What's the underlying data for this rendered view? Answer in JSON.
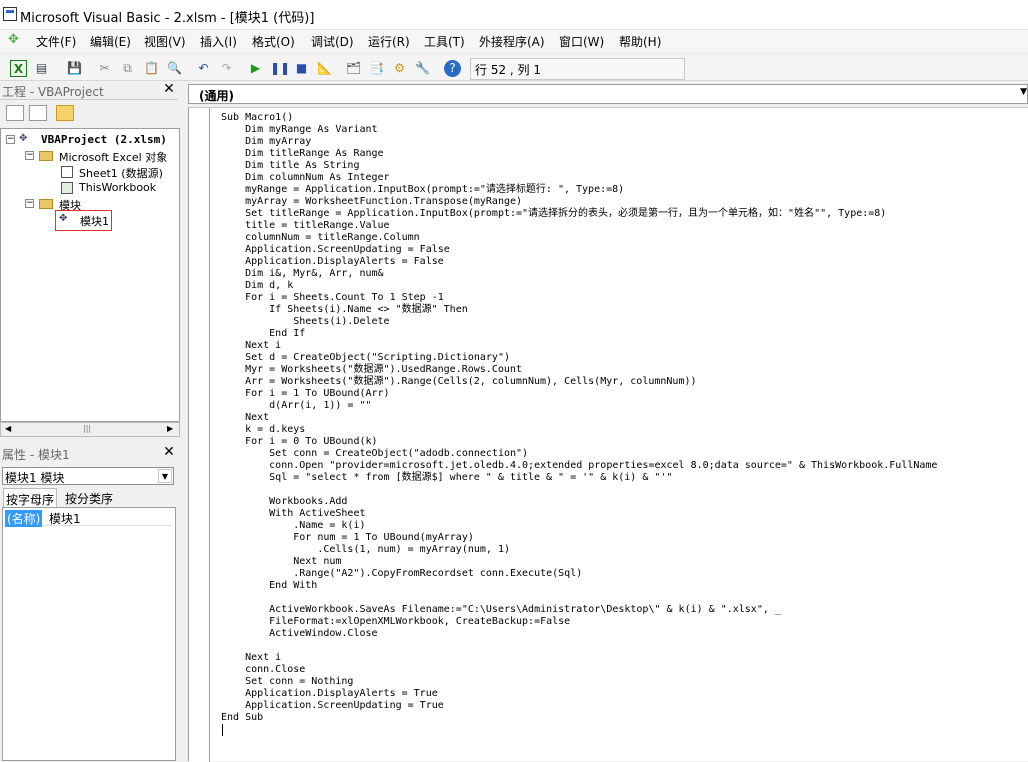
{
  "window": {
    "title": "Microsoft Visual Basic - 2.xlsm - [模块1 (代码)]"
  },
  "menu": [
    "文件(F)",
    "编辑(E)",
    "视图(V)",
    "插入(I)",
    "格式(O)",
    "调试(D)",
    "运行(R)",
    "工具(T)",
    "外接程序(A)",
    "窗口(W)",
    "帮助(H)"
  ],
  "toolbar": {
    "position": "行 52 , 列 1"
  },
  "project": {
    "pane_title": "工程 - VBAProject",
    "root": "VBAProject (2.xlsm)",
    "excel_objects": "Microsoft Excel 对象",
    "sheet1": "Sheet1 (数据源)",
    "thisworkbook": "ThisWorkbook",
    "modules_folder": "模块",
    "module1": "模块1"
  },
  "properties": {
    "pane_title": "属性 - 模块1",
    "object": "模块1  模块",
    "tab_alpha": "按字母序",
    "tab_category": "按分类序",
    "name_key": "(名称)",
    "name_value": "模块1"
  },
  "code": {
    "object_dropdown": "(通用)",
    "lines": [
      "Sub Macro1()",
      "    Dim myRange As Variant",
      "    Dim myArray",
      "    Dim titleRange As Range",
      "    Dim title As String",
      "    Dim columnNum As Integer",
      "    myRange = Application.InputBox(prompt:=\"请选择标题行: \", Type:=8)",
      "    myArray = WorksheetFunction.Transpose(myRange)",
      "    Set titleRange = Application.InputBox(prompt:=\"请选择拆分的表头，必须是第一行，且为一个单元格，如：\"姓名\"\", Type:=8)",
      "    title = titleRange.Value",
      "    columnNum = titleRange.Column",
      "    Application.ScreenUpdating = False",
      "    Application.DisplayAlerts = False",
      "    Dim i&, Myr&, Arr, num&",
      "    Dim d, k",
      "    For i = Sheets.Count To 1 Step -1",
      "        If Sheets(i).Name <> \"数据源\" Then",
      "            Sheets(i).Delete",
      "        End If",
      "    Next i",
      "    Set d = CreateObject(\"Scripting.Dictionary\")",
      "    Myr = Worksheets(\"数据源\").UsedRange.Rows.Count",
      "    Arr = Worksheets(\"数据源\").Range(Cells(2, columnNum), Cells(Myr, columnNum))",
      "    For i = 1 To UBound(Arr)",
      "        d(Arr(i, 1)) = \"\"",
      "    Next",
      "    k = d.keys",
      "    For i = 0 To UBound(k)",
      "        Set conn = CreateObject(\"adodb.connection\")",
      "        conn.Open \"provider=microsoft.jet.oledb.4.0;extended properties=excel 8.0;data source=\" & ThisWorkbook.FullName",
      "        Sql = \"select * from [数据源$] where \" & title & \" = '\" & k(i) & \"'\"",
      "",
      "        Workbooks.Add",
      "        With ActiveSheet",
      "            .Name = k(i)",
      "            For num = 1 To UBound(myArray)",
      "                .Cells(1, num) = myArray(num, 1)",
      "            Next num",
      "            .Range(\"A2\").CopyFromRecordset conn.Execute(Sql)",
      "        End With",
      "",
      "        ActiveWorkbook.SaveAs Filename:=\"C:\\Users\\Administrator\\Desktop\\\" & k(i) & \".xlsx\", _",
      "        FileFormat:=xlOpenXMLWorkbook, CreateBackup:=False",
      "        ActiveWindow.Close",
      "",
      "    Next i",
      "    conn.Close",
      "    Set conn = Nothing",
      "    Application.DisplayAlerts = True",
      "    Application.ScreenUpdating = True",
      "End Sub"
    ]
  }
}
